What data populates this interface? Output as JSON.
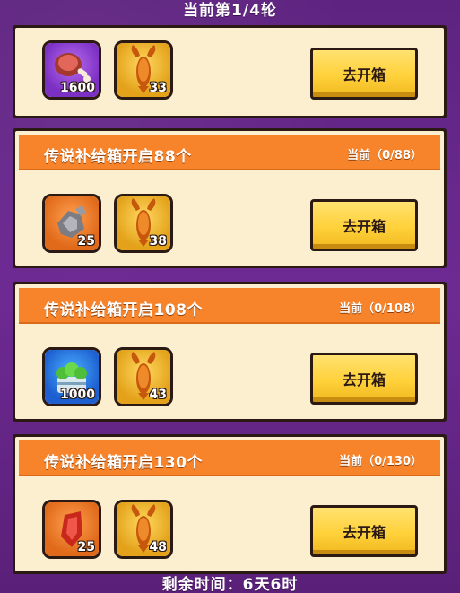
{
  "header": {
    "round_text": "当前第1/4轮"
  },
  "footer": {
    "remaining_text": "剩余时间：6天6时"
  },
  "colors": {
    "background": "#6a2a8e",
    "card_bg": "#fcefd0",
    "card_header": "#f7832a",
    "button": "#ffd13a",
    "border": "#2b1a14"
  },
  "cards": [
    {
      "title": "",
      "progress": "",
      "rewards": [
        {
          "icon": "meat-icon",
          "count": "1600",
          "tile": "purple"
        },
        {
          "icon": "lobster-icon",
          "count": "33",
          "tile": "gold"
        }
      ],
      "button_label": "去开箱"
    },
    {
      "title": "传说补给箱开启88个",
      "progress": "当前（0/88）",
      "rewards": [
        {
          "icon": "ore-icon",
          "count": "25",
          "tile": "orange"
        },
        {
          "icon": "lobster-icon",
          "count": "38",
          "tile": "gold"
        }
      ],
      "button_label": "去开箱"
    },
    {
      "title": "传说补给箱开启108个",
      "progress": "当前（0/108）",
      "rewards": [
        {
          "icon": "vegetable-basket-icon",
          "count": "1000",
          "tile": "blue"
        },
        {
          "icon": "lobster-icon",
          "count": "43",
          "tile": "gold"
        }
      ],
      "button_label": "去开箱"
    },
    {
      "title": "传说补给箱开启130个",
      "progress": "当前（0/130）",
      "rewards": [
        {
          "icon": "crystal-icon",
          "count": "25",
          "tile": "orange"
        },
        {
          "icon": "lobster-icon",
          "count": "48",
          "tile": "gold"
        }
      ],
      "button_label": "去开箱"
    }
  ]
}
